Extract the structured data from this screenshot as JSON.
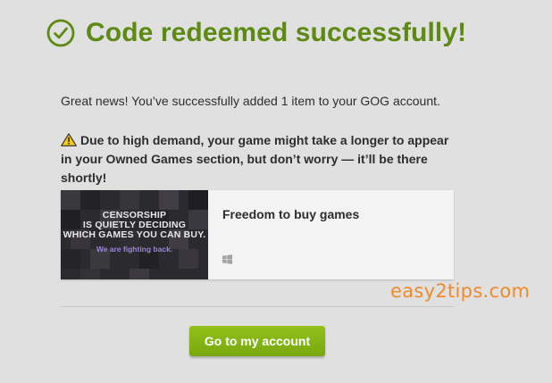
{
  "header": {
    "title": "Code redeemed successfully!",
    "icon": "check-circle-icon",
    "accent_color": "#5d8a12"
  },
  "messages": {
    "success": "Great news! You’ve successfully added 1 item to your GOG account.",
    "warning_icon": "warning-icon",
    "warning": "Due to high demand, your game might take a longer to appear in your Owned Games section, but don’t worry — it’ll be there shortly!"
  },
  "product": {
    "name": "Freedom to buy games",
    "thumbnail": {
      "lines": [
        "CENSORSHIP",
        "IS QUIETLY DECIDING",
        "WHICH GAMES YOU CAN BUY."
      ],
      "tagline": "We are fighting back."
    },
    "platform_icon": "windows-icon"
  },
  "actions": {
    "account_button": "Go to my account",
    "button_color": "#85b414"
  },
  "watermark": "easy2tips.com"
}
